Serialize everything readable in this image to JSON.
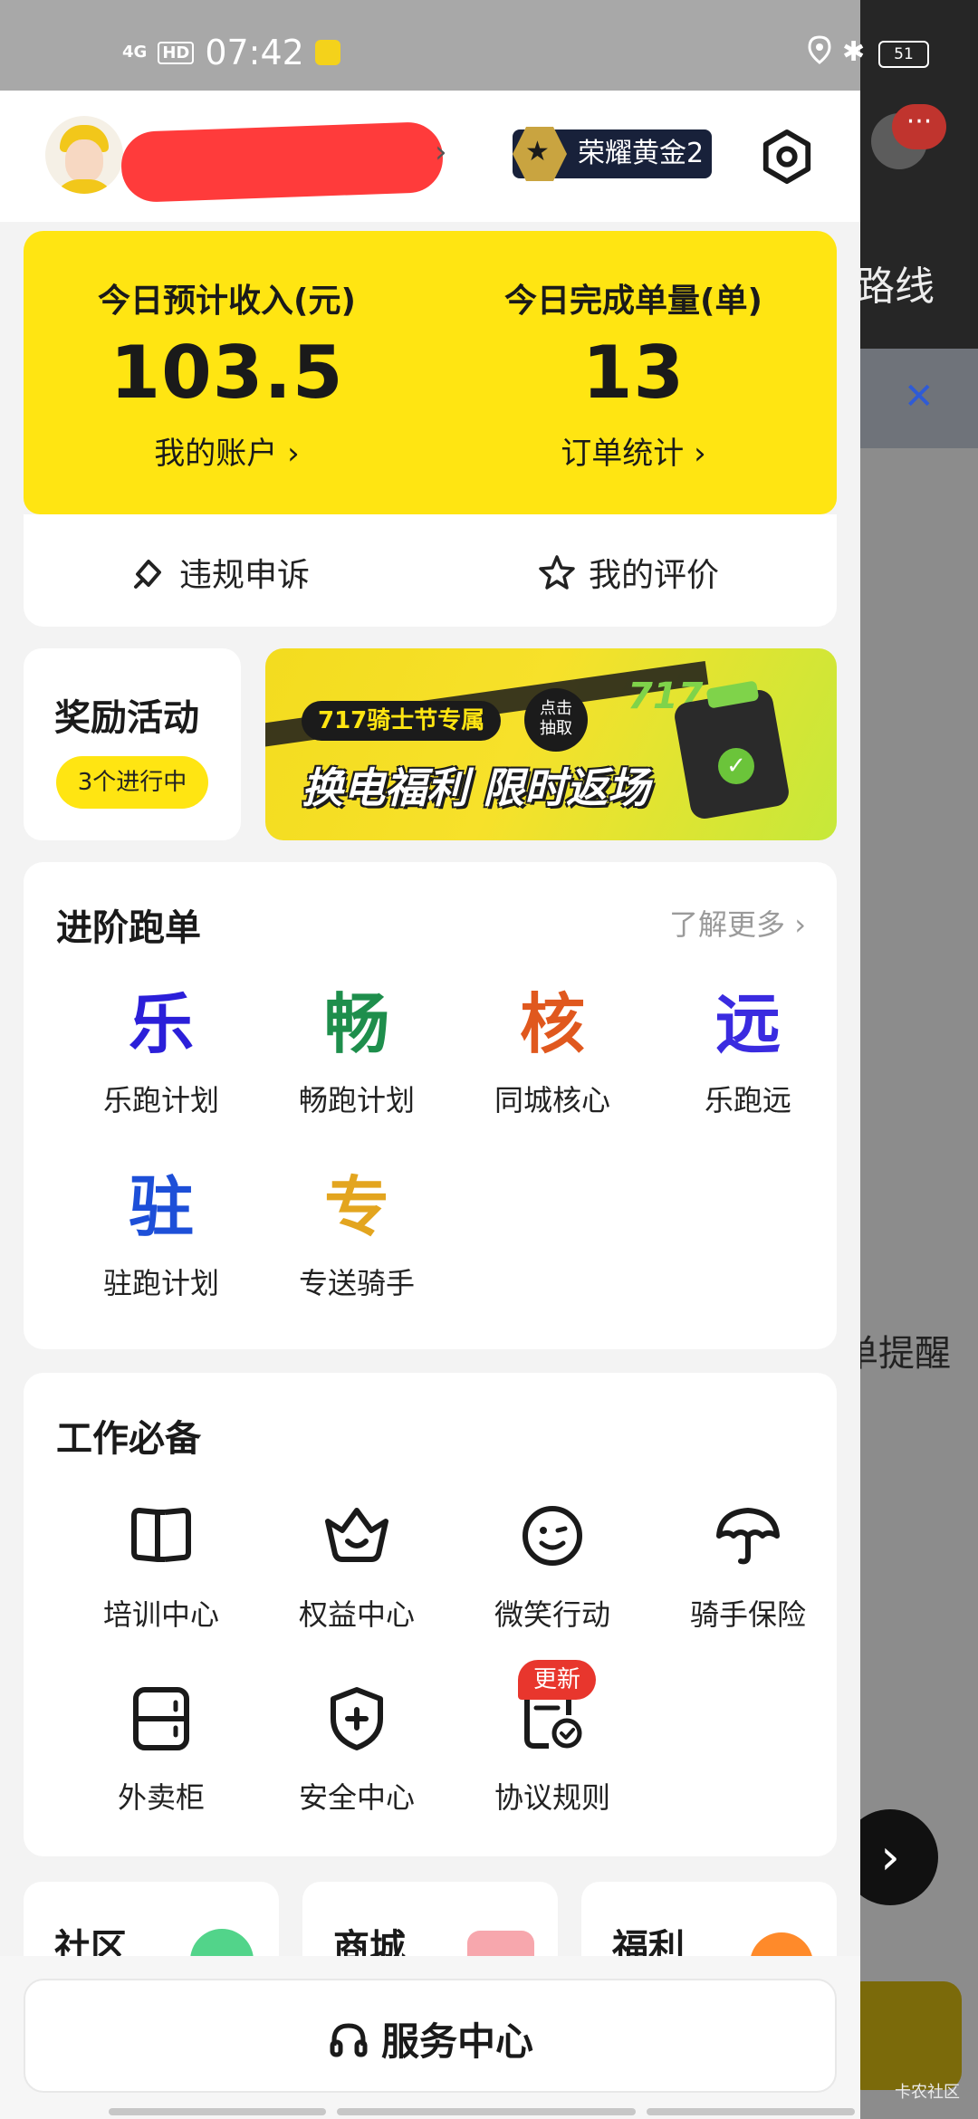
{
  "status_bar": {
    "network": "4G",
    "hd": "HD",
    "time": "07:42",
    "battery": "51"
  },
  "header": {
    "rank_badge": "荣耀黄金2",
    "icons": [
      "avatar",
      "settings-icon"
    ]
  },
  "income_card": {
    "estimated_income_label": "今日预计收入(元)",
    "estimated_income_value": "103.5",
    "account_link": "我的账户 ›",
    "completed_orders_label": "今日完成单量(单)",
    "completed_orders_value": "13",
    "order_stats_link": "订单统计 ›",
    "accent_color": "#FFE512"
  },
  "sub_actions": {
    "appeal": "违规申诉",
    "my_rating": "我的评价"
  },
  "reward": {
    "title": "奖励活动",
    "status": "3个进行中"
  },
  "banner": {
    "tag": "717骑士节专属",
    "badge_line1": "点击",
    "badge_line2": "抽取",
    "headline": "换电福利 限时返场",
    "mark": "717"
  },
  "advanced": {
    "title": "进阶跑单",
    "more": "了解更多 ›",
    "items": [
      {
        "glyph": "乐",
        "label": "乐跑计划",
        "color": "#2B1FD9"
      },
      {
        "glyph": "畅",
        "label": "畅跑计划",
        "color": "#1E8E4C"
      },
      {
        "glyph": "核",
        "label": "同城核心",
        "color": "#E0581E"
      },
      {
        "glyph": "远",
        "label": "乐跑远",
        "color": "#3A2BE0"
      },
      {
        "glyph": "驻",
        "label": "驻跑计划",
        "color": "#1D4FD8"
      },
      {
        "glyph": "专",
        "label": "专送骑手",
        "color": "#E3A51F"
      }
    ]
  },
  "work": {
    "title": "工作必备",
    "items": [
      {
        "label": "培训中心",
        "icon": "book-icon"
      },
      {
        "label": "权益中心",
        "icon": "crown-icon"
      },
      {
        "label": "微笑行动",
        "icon": "smile-icon"
      },
      {
        "label": "骑手保险",
        "icon": "umbrella-icon"
      },
      {
        "label": "外卖柜",
        "icon": "cabinet-icon"
      },
      {
        "label": "安全中心",
        "icon": "shield-icon"
      },
      {
        "label": "协议规则",
        "icon": "document-check-icon"
      }
    ],
    "update_badge": "更新"
  },
  "bottom": {
    "community": "社区",
    "mall": "商城",
    "welfare": "福利"
  },
  "service": {
    "label": "服务中心"
  },
  "background_app": {
    "route": "路线",
    "remind": "单提醒",
    "notif_badge": "···"
  },
  "watermark": "卡农社区"
}
